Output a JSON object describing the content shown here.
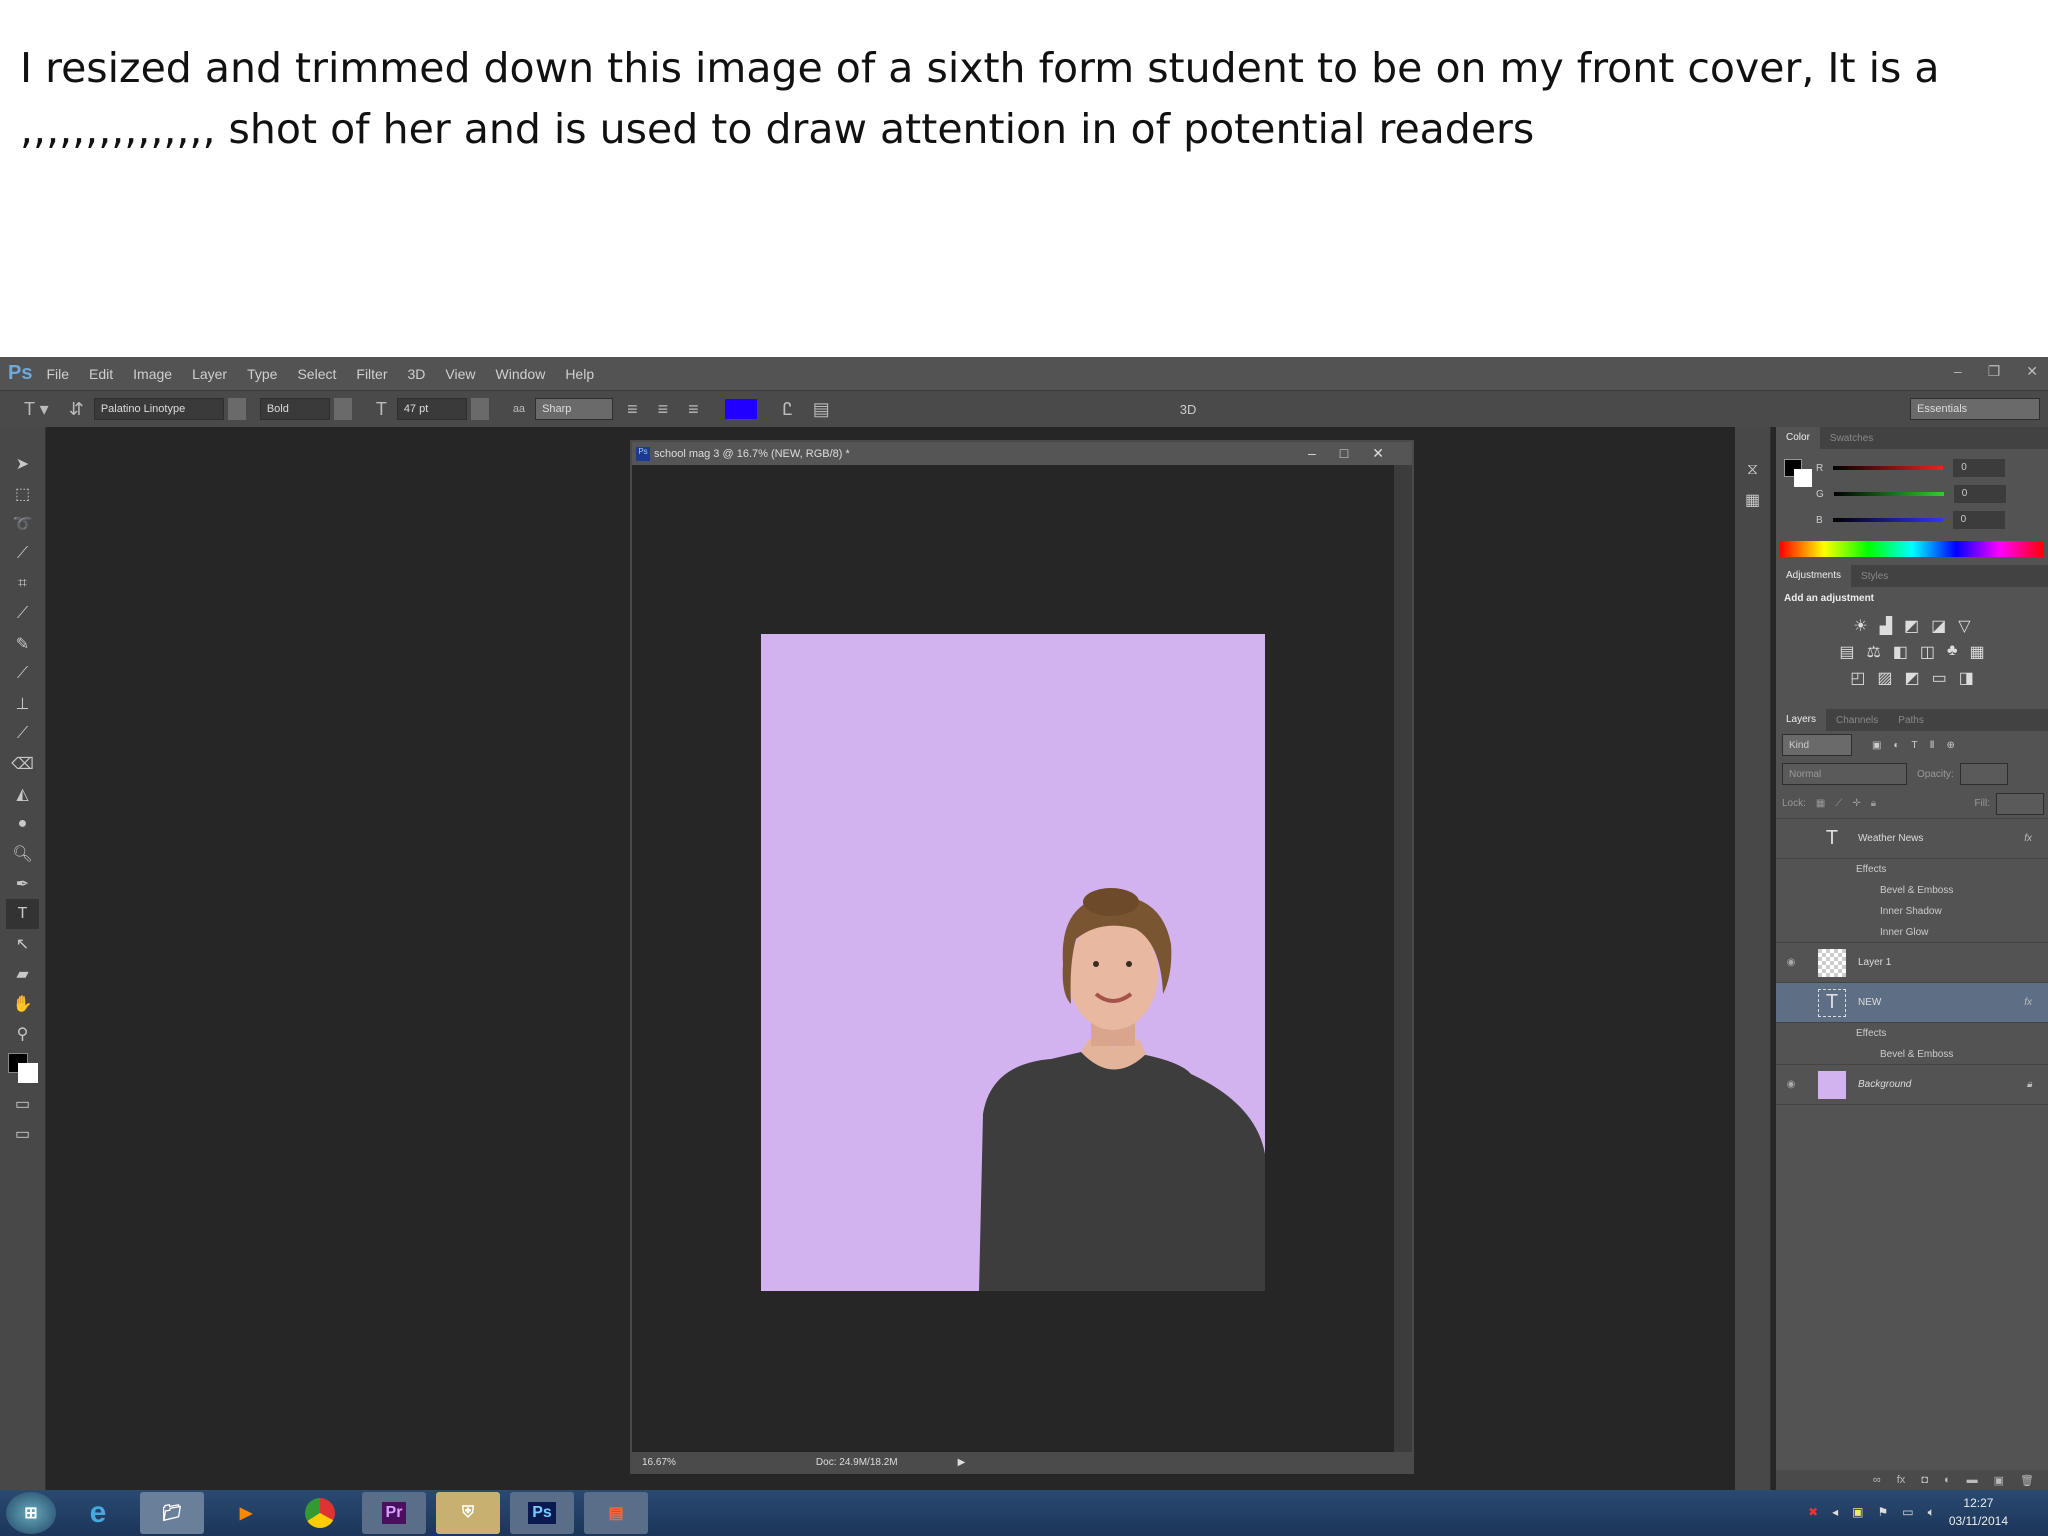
{
  "caption": {
    "line1": "I resized and trimmed down this image of a sixth form student to be on my front cover, It is a",
    "line2": ",,,,,,,,,,,,,,, shot of her and is used to draw attention in of potential readers"
  },
  "app": {
    "logo": "Ps",
    "menu": [
      "File",
      "Edit",
      "Image",
      "Layer",
      "Type",
      "Select",
      "Filter",
      "3D",
      "View",
      "Window",
      "Help"
    ]
  },
  "options": {
    "font_family": "Palatino Linotype",
    "font_style": "Bold",
    "font_size": "47 pt",
    "antialias": "Sharp",
    "text_color": "#2200ff",
    "mode_3d": "3D",
    "workspace": "Essentials"
  },
  "document": {
    "title": "school mag 3 @ 16.7% (NEW, RGB/8) *",
    "zoom": "16.67%",
    "doc_size": "Doc: 24.9M/18.2M",
    "canvas_color": "#d3b3ef"
  },
  "panels": {
    "color": {
      "tabs": [
        "Color",
        "Swatches"
      ],
      "r": "0",
      "g": "0",
      "b": "0"
    },
    "adjustments": {
      "tabs": [
        "Adjustments",
        "Styles"
      ],
      "heading": "Add an adjustment"
    },
    "layers": {
      "tabs": [
        "Layers",
        "Channels",
        "Paths"
      ],
      "filter": "Kind",
      "blend": "Normal",
      "opacity_label": "Opacity:",
      "lock_label": "Lock:",
      "fill_label": "Fill:",
      "items": [
        {
          "name": "Weather News",
          "effects": "Effects",
          "sub": [
            "Bevel & Emboss",
            "Inner Shadow",
            "Inner Glow"
          ]
        },
        {
          "name": "Layer 1"
        },
        {
          "name": "NEW",
          "effects": "Effects",
          "sub": [
            "Bevel & Emboss"
          ]
        },
        {
          "name": "Background"
        }
      ]
    }
  },
  "taskbar": {
    "time": "12:27",
    "date": "03/11/2014",
    "apps": [
      "Pr",
      "Ps"
    ]
  }
}
